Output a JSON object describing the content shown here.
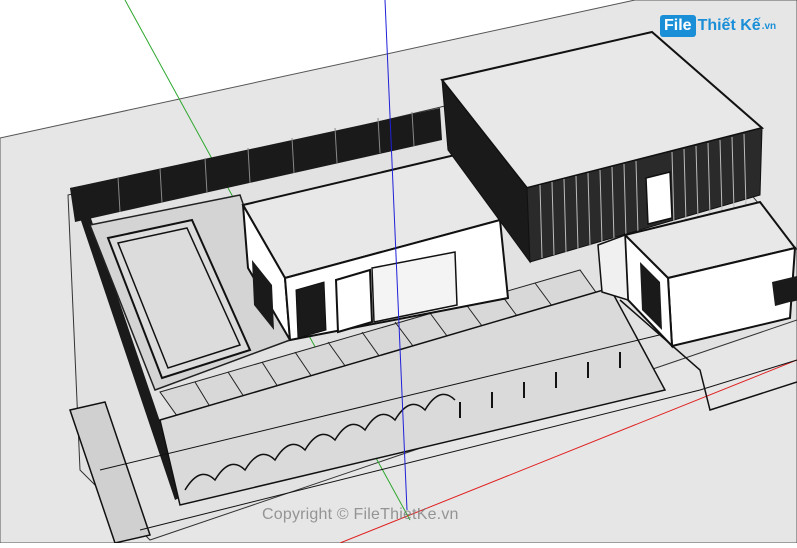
{
  "watermark": {
    "logo_badge": "File",
    "logo_name": "Thiết Kế",
    "logo_tld": ".vn",
    "copyright": "Copyright © FileThietKe.vn"
  },
  "colors": {
    "ground": "#e6e6e6",
    "lot": "#d9d9d9",
    "wall": "#ffffff",
    "roof": "#ececec",
    "dark": "#1a1a1a",
    "axis_red": "#e02020",
    "axis_green": "#2fa82f",
    "axis_blue": "#2020d8",
    "logo_blue": "#1a8fd8"
  },
  "scene": {
    "description_icons": [
      "house-model",
      "pool",
      "fence",
      "axis-lines"
    ]
  }
}
